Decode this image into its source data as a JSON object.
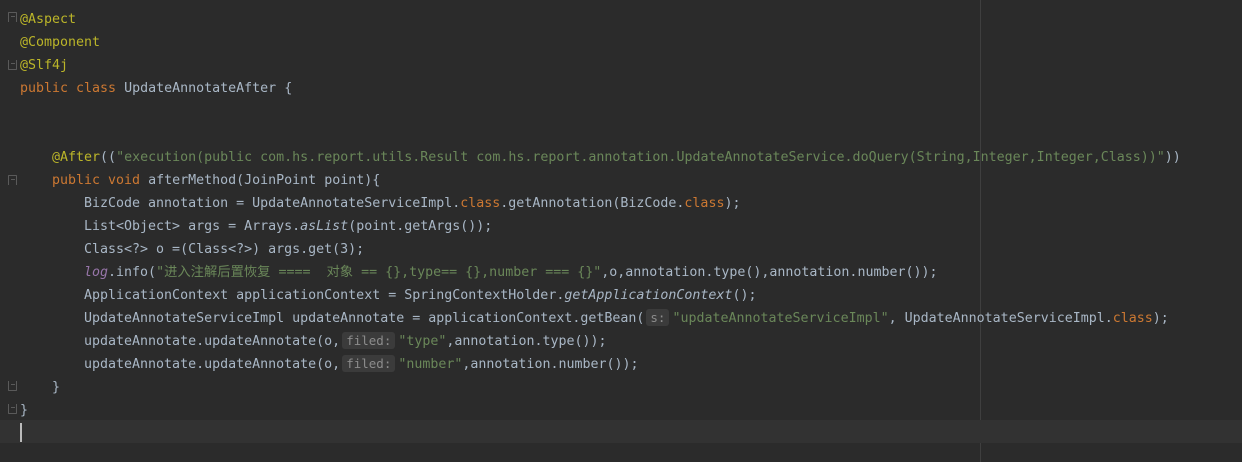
{
  "code": {
    "l1": "@Aspect",
    "l2": "@Component",
    "l3": "@Slf4j",
    "l4_kw": "public class ",
    "l4_name": "UpdateAnnotateAfter",
    "l4_tail": " {",
    "l7_ann": "@After",
    "l7_open": "((",
    "l7_str": "\"execution(public com.hs.report.utils.Result com.hs.report.annotation.UpdateAnnotateService.doQuery(String,Integer,Integer,Class))\"",
    "l7_close": "))",
    "l8_kw": "public void ",
    "l8_rest": "afterMethod(JoinPoint point){",
    "l9_a": "BizCode annotation = UpdateAnnotateServiceImpl.",
    "l9_kw": "class",
    "l9_b": ".getAnnotation(BizCode.",
    "l9_kw2": "class",
    "l9_c": ");",
    "l10_a": "List<Object> args = Arrays.",
    "l10_it": "asList",
    "l10_b": "(point.getArgs());",
    "l11": "Class<?> o =(Class<?>) args.get(3);",
    "l12_fld": "log",
    "l12_a": ".info(",
    "l12_str": "\"进入注解后置恢复 ====  对象 == {},type== {},number === {}\"",
    "l12_b": ",o,annotation.type(),annotation.number());",
    "l13_a": "ApplicationContext applicationContext = SpringContextHolder.",
    "l13_it": "getApplicationContext",
    "l13_b": "();",
    "l14_a": "UpdateAnnotateServiceImpl updateAnnotate = applicationContext.getBean(",
    "l14_hint": "s:",
    "l14_str": "\"updateAnnotateServiceImpl\"",
    "l14_b": ", UpdateAnnotateServiceImpl.",
    "l14_kw": "class",
    "l14_c": ");",
    "l15_a": "updateAnnotate.updateAnnotate(o,",
    "l15_hint": "filed:",
    "l15_str": "\"type\"",
    "l15_b": ",annotation.type());",
    "l16_a": "updateAnnotate.updateAnnotate(o,",
    "l16_hint": "filed:",
    "l16_str": "\"number\"",
    "l16_b": ",annotation.number());",
    "l17": "}",
    "l18": "}"
  },
  "colors": {
    "background": "#2b2b2b",
    "annotation": "#bbb529",
    "keyword": "#cc7832",
    "string": "#6a8759",
    "field": "#9876aa",
    "text": "#a9b7c6"
  }
}
